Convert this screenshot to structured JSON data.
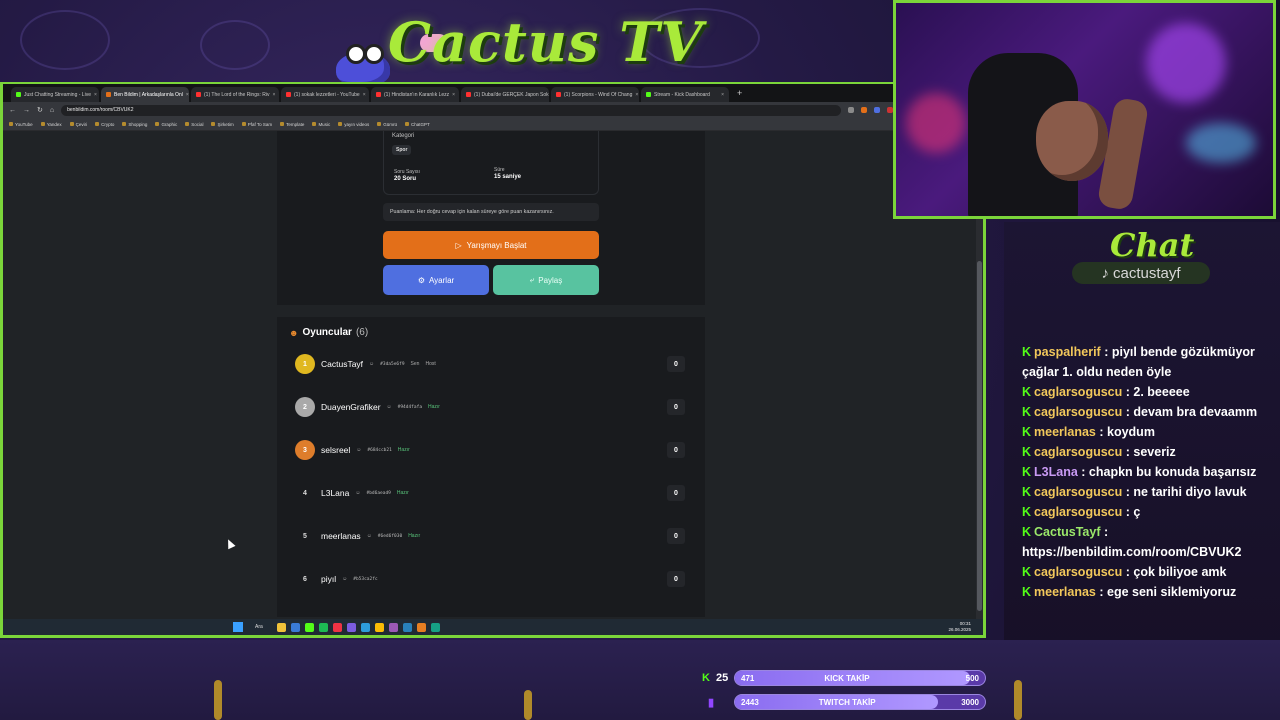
{
  "overlay": {
    "brand_title": "Cactus TV",
    "chat_title": "Chat",
    "chat_handle": "cactustayf"
  },
  "browser": {
    "tabs": [
      {
        "label": "Just Chatting Streaming - Live",
        "active": false,
        "color": "#53fc18"
      },
      {
        "label": "Ben Bildim | Arkadaşlarınla Onl",
        "active": true,
        "color": "#e36f19"
      },
      {
        "label": "(1) The Lord of the Rings: Riv",
        "active": false,
        "color": "#ff3030"
      },
      {
        "label": "(1) sokak lezzetleri - YouTube",
        "active": false,
        "color": "#ff3030"
      },
      {
        "label": "(1) Hindistan'ın Karanlık Lezz",
        "active": false,
        "color": "#ff3030"
      },
      {
        "label": "(1) Dubai'de GERÇEK Japon Sok",
        "active": false,
        "color": "#ff3030"
      },
      {
        "label": "(1) Scorpions - Wind Of Chang",
        "active": false,
        "color": "#ff3030"
      },
      {
        "label": "Stream - Kick Dashboard",
        "active": false,
        "color": "#53fc18"
      }
    ],
    "url": "benbildim.com/room/CBVUK2",
    "bookmarks": [
      "YouTube",
      "Yandex",
      "Çeviri",
      "Crypto",
      "Shopping",
      "Graphic",
      "Social",
      "Şirketim",
      "Pfaf To Sam",
      "Template",
      "Music",
      "yayın videos",
      "Gümrü",
      "ChatGPT"
    ]
  },
  "game": {
    "category_label": "Kategori",
    "category_value": "Spor",
    "question_count_label": "Soru Sayısı",
    "question_count_value": "20 Soru",
    "duration_label": "Süre",
    "duration_value": "15 saniye",
    "scoring_note": "Puanlama: Her doğru cevap için kalan süreye göre puan kazanırsınız.",
    "start_button": "Yarışmayı Başlat",
    "settings_button": "Ayarlar",
    "share_button": "Paylaş"
  },
  "players": {
    "title": "Oyuncular",
    "count": "(6)",
    "list": [
      {
        "rank": "1",
        "name": "CactusTayf",
        "hash": "#3da5e6f9",
        "tags": [
          "Sen",
          "Host"
        ],
        "score": "0"
      },
      {
        "rank": "2",
        "name": "DuayenGrafiker",
        "hash": "#94d4fafa",
        "tags": [
          "Hazır"
        ],
        "score": "0"
      },
      {
        "rank": "3",
        "name": "selsreel",
        "hash": "#684ccb21",
        "tags": [
          "Hazır"
        ],
        "score": "0"
      },
      {
        "rank": "4",
        "name": "L3Lana",
        "hash": "#bd6aead9",
        "tags": [
          "Hazır"
        ],
        "score": "0"
      },
      {
        "rank": "5",
        "name": "meerlanas",
        "hash": "#6ed6f030",
        "tags": [
          "Hazır"
        ],
        "score": "0"
      },
      {
        "rank": "6",
        "name": "piyıl",
        "hash": "#b53ca2fc",
        "tags": [],
        "score": "0"
      }
    ]
  },
  "taskbar": {
    "search_label": "Ara",
    "time": "00:31",
    "date": "26.06.2025"
  },
  "chat": {
    "messages": [
      {
        "user": "paspalherif",
        "text": ": piyıl bende gözükmüyor çağlar 1. oldu neden öyle"
      },
      {
        "user": "caglarsoguscu",
        "text": ": 2. beeeee"
      },
      {
        "user": "caglarsoguscu",
        "text": ": devam bra devaamm"
      },
      {
        "user": "meerlanas",
        "text": ": koydum"
      },
      {
        "user": "caglarsoguscu",
        "text": ": severiz"
      },
      {
        "user": "L3Lana",
        "text": ": chapkn bu konuda başarısız"
      },
      {
        "user": "caglarsoguscu",
        "text": ": ne tarihi diyo lavuk"
      },
      {
        "user": "caglarsoguscu",
        "text": ": ç"
      },
      {
        "user": "CactusTayf",
        "text": ": https://benbildim.com/room/CBVUK2"
      },
      {
        "user": "caglarsoguscu",
        "text": ": çok biliyoe amk"
      },
      {
        "user": "meerlanas",
        "text": ": ege seni siklemiyoruz"
      }
    ]
  },
  "goals": {
    "kick": {
      "count": "25",
      "current": "471",
      "label": "KICK TAKİP",
      "target": "500",
      "progress": 0.94
    },
    "twitch": {
      "current": "2443",
      "label": "TWITCH TAKİP",
      "target": "3000",
      "progress": 0.81
    }
  }
}
